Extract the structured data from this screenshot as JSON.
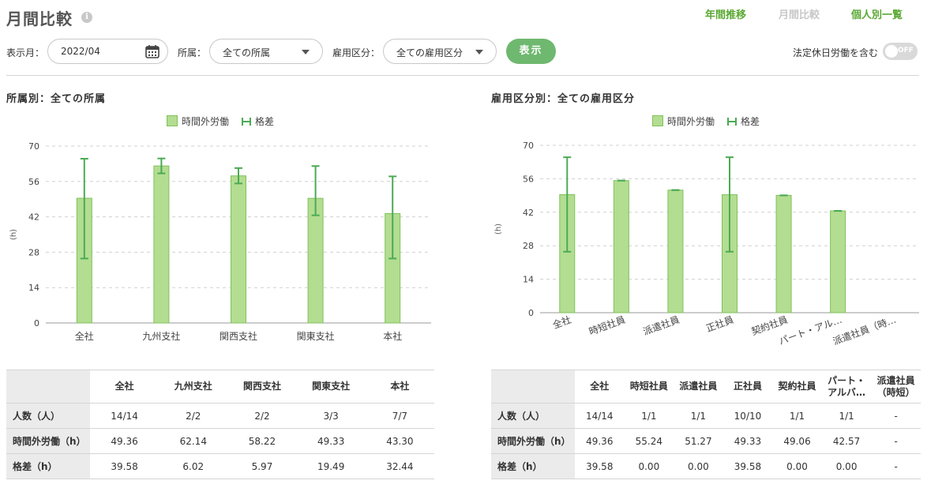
{
  "page": {
    "title": "月間比較",
    "info_icon": "i"
  },
  "nav": {
    "annual": "年間推移",
    "monthly": "月間比較",
    "individual": "個人別一覧"
  },
  "filters": {
    "month_label": "表示月：",
    "month_value": "2022/04",
    "dept_label": "所属：",
    "dept_value": "全ての所属",
    "emp_label": "雇用区分：",
    "emp_value": "全ての雇用区分",
    "show_button": "表示",
    "holiday_label": "法定休日労働を含む",
    "holiday_state": "OFF"
  },
  "colors": {
    "accent": "#5aa832",
    "bar_fill": "#b3dd91",
    "bar_stroke": "#7fc25a",
    "error_bar": "#4caa55",
    "button": "#6fb86f"
  },
  "legend": {
    "bar": "時間外労働",
    "error": "格差"
  },
  "chart_data": [
    {
      "type": "bar",
      "title": "所属別：全ての所属",
      "ylabel": "(h)",
      "ylim": [
        0,
        70
      ],
      "yticks": [
        0,
        14,
        28,
        42,
        56,
        70
      ],
      "categories": [
        "全社",
        "九州支社",
        "関西支社",
        "関東支社",
        "本社"
      ],
      "series": [
        {
          "name": "時間外労働",
          "values": [
            49.36,
            62.14,
            58.22,
            49.33,
            43.3
          ]
        }
      ],
      "error_bars": [
        [
          25.5,
          65.0
        ],
        [
          59.2,
          65.1
        ],
        [
          55.2,
          61.3
        ],
        [
          42.6,
          62.1
        ],
        [
          25.5,
          58.0
        ]
      ],
      "legend": "top"
    },
    {
      "type": "bar",
      "title": "雇用区分別：全ての雇用区分",
      "ylabel": "(h)",
      "ylim": [
        0,
        70
      ],
      "yticks": [
        0,
        14,
        28,
        42,
        56,
        70
      ],
      "categories": [
        "全社",
        "時短社員",
        "派遣社員",
        "正社員",
        "契約社員",
        "パート・アル…",
        "派遣社員（時…"
      ],
      "series": [
        {
          "name": "時間外労働",
          "values": [
            49.36,
            55.24,
            51.27,
            49.33,
            49.06,
            42.57,
            0
          ]
        }
      ],
      "error_bars": [
        [
          25.5,
          65.0
        ],
        [
          55.24,
          55.24
        ],
        [
          51.27,
          51.27
        ],
        [
          25.5,
          65.0
        ],
        [
          49.06,
          49.06
        ],
        [
          42.57,
          42.57
        ],
        null
      ],
      "legend": "top"
    }
  ],
  "table_dept": {
    "columns": [
      "全社",
      "九州支社",
      "関西支社",
      "関東支社",
      "本社"
    ],
    "rows": [
      {
        "label": "人数（人）",
        "values": [
          "14/14",
          "2/2",
          "2/2",
          "3/3",
          "7/7"
        ]
      },
      {
        "label": "時間外労働（h）",
        "values": [
          "49.36",
          "62.14",
          "58.22",
          "49.33",
          "43.30"
        ]
      },
      {
        "label": "格差（h）",
        "values": [
          "39.58",
          "6.02",
          "5.97",
          "19.49",
          "32.44"
        ]
      }
    ]
  },
  "table_emp": {
    "columns": [
      "全社",
      "時短社員",
      "派遣社員",
      "正社員",
      "契約社員",
      "パート・\nアルバ…",
      "派遣社員\n（時短）"
    ],
    "rows": [
      {
        "label": "人数（人）",
        "values": [
          "14/14",
          "1/1",
          "1/1",
          "10/10",
          "1/1",
          "1/1",
          "-"
        ]
      },
      {
        "label": "時間外労働（h）",
        "values": [
          "49.36",
          "55.24",
          "51.27",
          "49.33",
          "49.06",
          "42.57",
          "-"
        ]
      },
      {
        "label": "格差（h）",
        "values": [
          "39.58",
          "0.00",
          "0.00",
          "39.58",
          "0.00",
          "0.00",
          "-"
        ]
      }
    ]
  }
}
